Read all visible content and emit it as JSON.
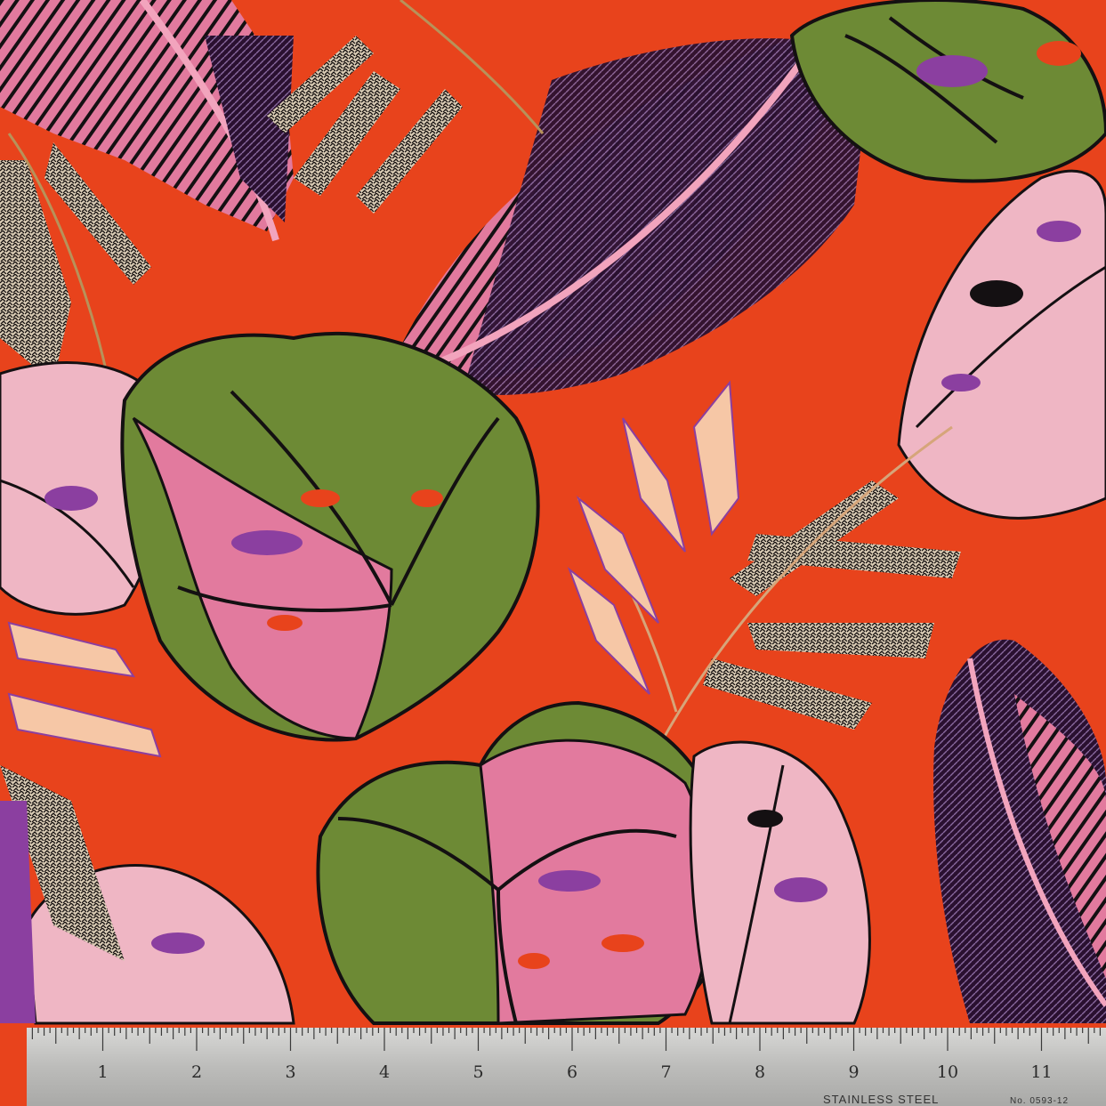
{
  "photo": {
    "subject": "fabric-swatch-with-ruler",
    "colors": {
      "background": "#e8431c",
      "pink": "#e27a9e",
      "light_pink": "#efb6c4",
      "green": "#6d8a35",
      "purple": "#3a1638",
      "violet": "#8b3fa0",
      "black": "#141012",
      "cream": "#f6e6d6",
      "ruler": "#c9c9c7"
    }
  },
  "ruler": {
    "numbers": [
      "1",
      "2",
      "3",
      "4",
      "5",
      "6",
      "7",
      "8",
      "9",
      "10",
      "11"
    ],
    "brand_text": "STAINLESS STEEL",
    "code_text": "No. 0593-12"
  }
}
